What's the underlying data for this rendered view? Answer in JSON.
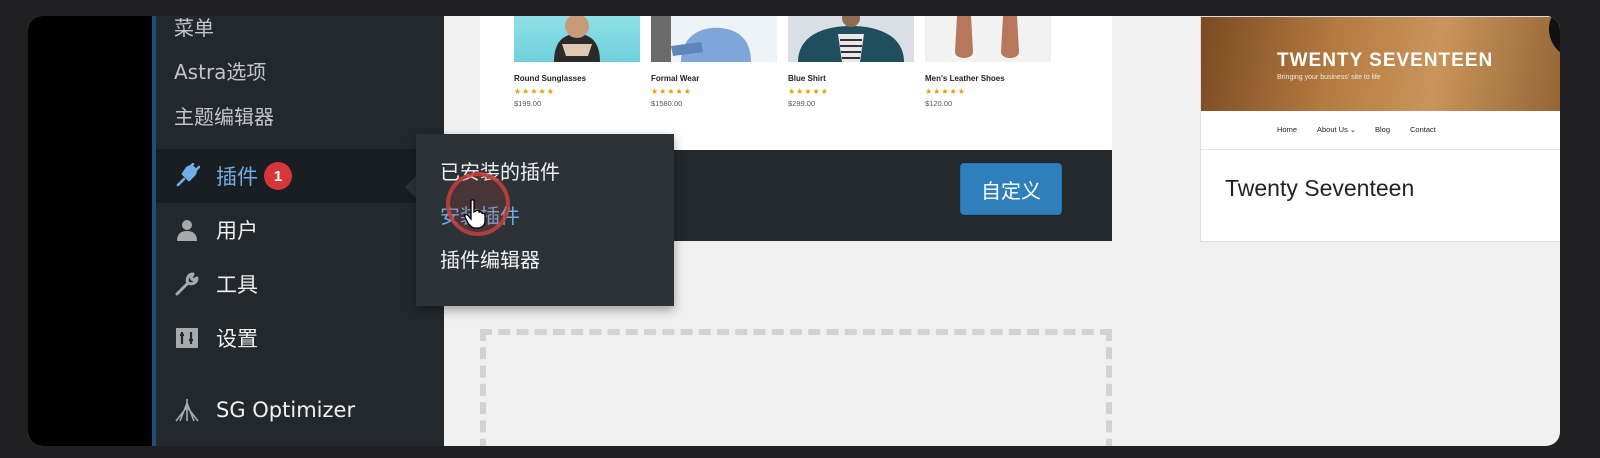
{
  "sidebar": {
    "sub_items": [
      {
        "label": "菜单"
      },
      {
        "label": "Astra选项"
      },
      {
        "label": "主题编辑器"
      }
    ],
    "items": [
      {
        "label": "插件",
        "icon": "plugin-icon",
        "badge": "1"
      },
      {
        "label": "用户",
        "icon": "user-icon"
      },
      {
        "label": "工具",
        "icon": "wrench-icon"
      },
      {
        "label": "设置",
        "icon": "settings-icon"
      },
      {
        "label": "SG Optimizer",
        "icon": "sg-optimizer-icon"
      }
    ]
  },
  "flyout": {
    "items": [
      {
        "label": "已安装的插件"
      },
      {
        "label": "安装插件"
      },
      {
        "label": "插件编辑器"
      }
    ]
  },
  "theme_card_1": {
    "products": [
      {
        "name": "Round Sunglasses",
        "stars": "★★★★★",
        "price": "$199.00"
      },
      {
        "name": "Formal Wear",
        "stars": "★★★★★",
        "price": "$1580.00"
      },
      {
        "name": "Blue Shirt",
        "stars": "★★★★★",
        "price": "$299.00"
      },
      {
        "name": "Men's Leather Shoes",
        "stars": "★★★★★",
        "price": "$120.00"
      }
    ],
    "customize_label": "自定义"
  },
  "theme_card_2": {
    "hero_title": "TWENTY SEVENTEEN",
    "hero_subtitle": "Bringing your business' site to life",
    "nav": [
      "Home",
      "About Us ⌄",
      "Blog",
      "Contact"
    ],
    "name": "Twenty Seventeen"
  },
  "colors": {
    "accent": "#72aee6",
    "badge": "#d63638",
    "button": "#2f7fbd",
    "sidebar": "#23282d"
  }
}
